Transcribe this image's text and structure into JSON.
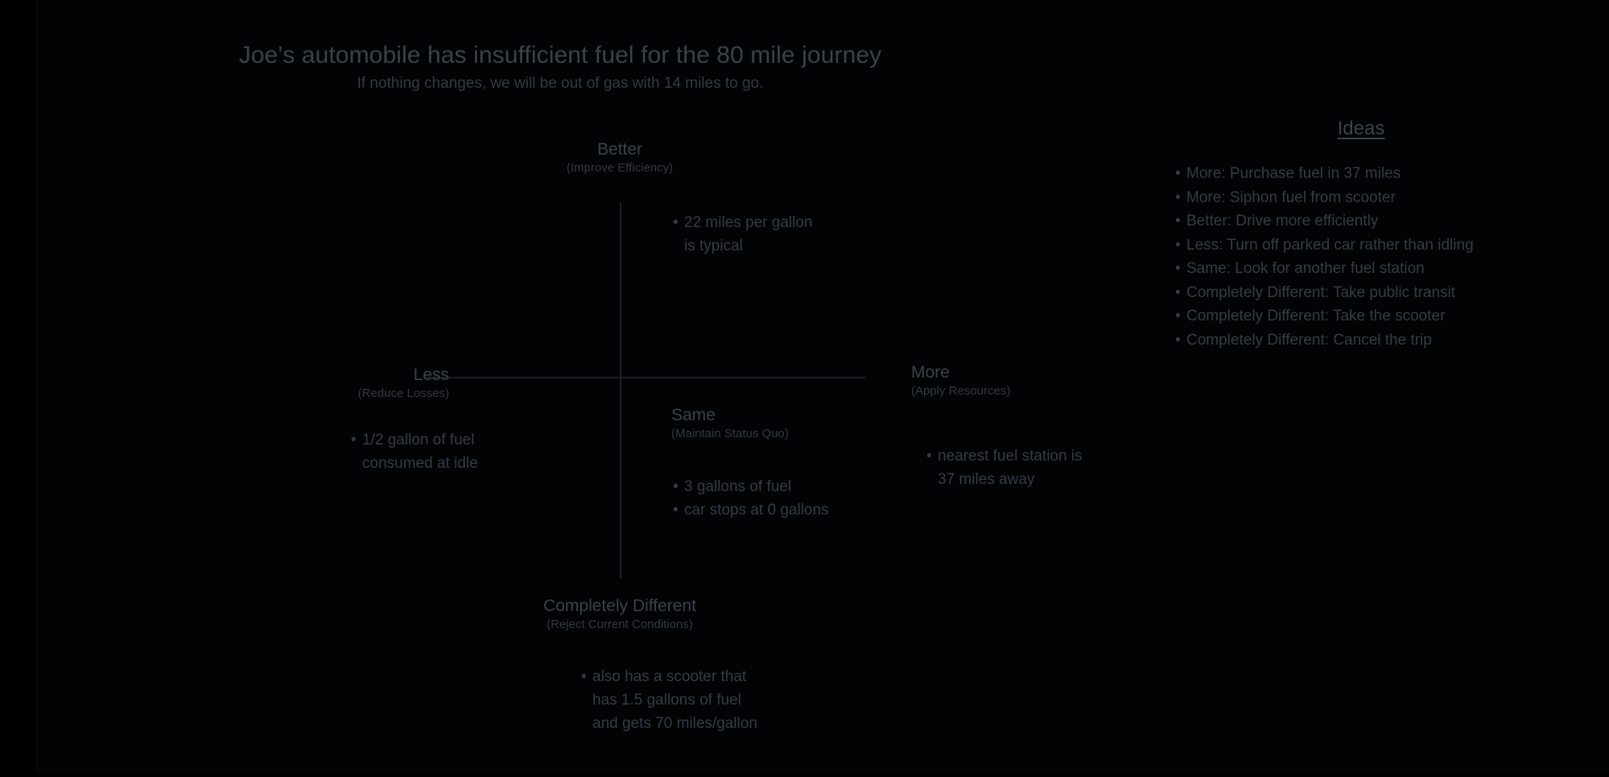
{
  "header": {
    "title": "Joe's automobile has insufficient fuel for the 80 mile journey",
    "subtitle": "If nothing changes, we will be out of gas with 14 miles to go."
  },
  "colors": {
    "background": "#000000",
    "stage": "#020304",
    "text_primary": "#39424d",
    "text_body": "#333c47",
    "text_sub": "#313944",
    "axis_line": "#1b2127"
  },
  "quadrants": {
    "better": {
      "label": "Better",
      "sublabel": "(Improve Efficiency)",
      "bullets": [
        {
          "dot": "•",
          "lines": [
            "22 miles per gallon",
            "is typical"
          ]
        }
      ]
    },
    "less": {
      "label": "Less",
      "sublabel": "(Reduce Losses)",
      "bullets": [
        {
          "dot": "•",
          "lines": [
            "1/2 gallon of fuel",
            "consumed at idle"
          ]
        }
      ]
    },
    "more": {
      "label": "More",
      "sublabel": "(Apply Resources)",
      "bullets": [
        {
          "dot": "•",
          "lines": [
            "nearest fuel station is",
            "37 miles away"
          ]
        }
      ]
    },
    "same": {
      "label": "Same",
      "sublabel": "(Maintain Status Quo)",
      "bullets": [
        {
          "dot": "•",
          "lines": [
            "3 gallons of fuel"
          ]
        },
        {
          "dot": "•",
          "lines": [
            "car stops at 0 gallons"
          ]
        }
      ]
    },
    "completely_different": {
      "label": "Completely Different",
      "sublabel": "(Reject Current Conditions)",
      "bullets": [
        {
          "dot": "•",
          "lines": [
            "also has a scooter that",
            "has 1.5 gallons of fuel",
            "and gets 70 miles/gallon"
          ]
        }
      ]
    }
  },
  "ideas": {
    "title": "Ideas",
    "bullet_glyph": "•",
    "items": [
      "More: Purchase fuel in 37 miles",
      "More: Siphon fuel from scooter",
      "Better: Drive more efficiently",
      "Less: Turn off parked car rather than idling",
      "Same: Look for another fuel station",
      "Completely Different: Take public transit",
      "Completely Different: Take the scooter",
      "Completely Different: Cancel the trip"
    ]
  }
}
